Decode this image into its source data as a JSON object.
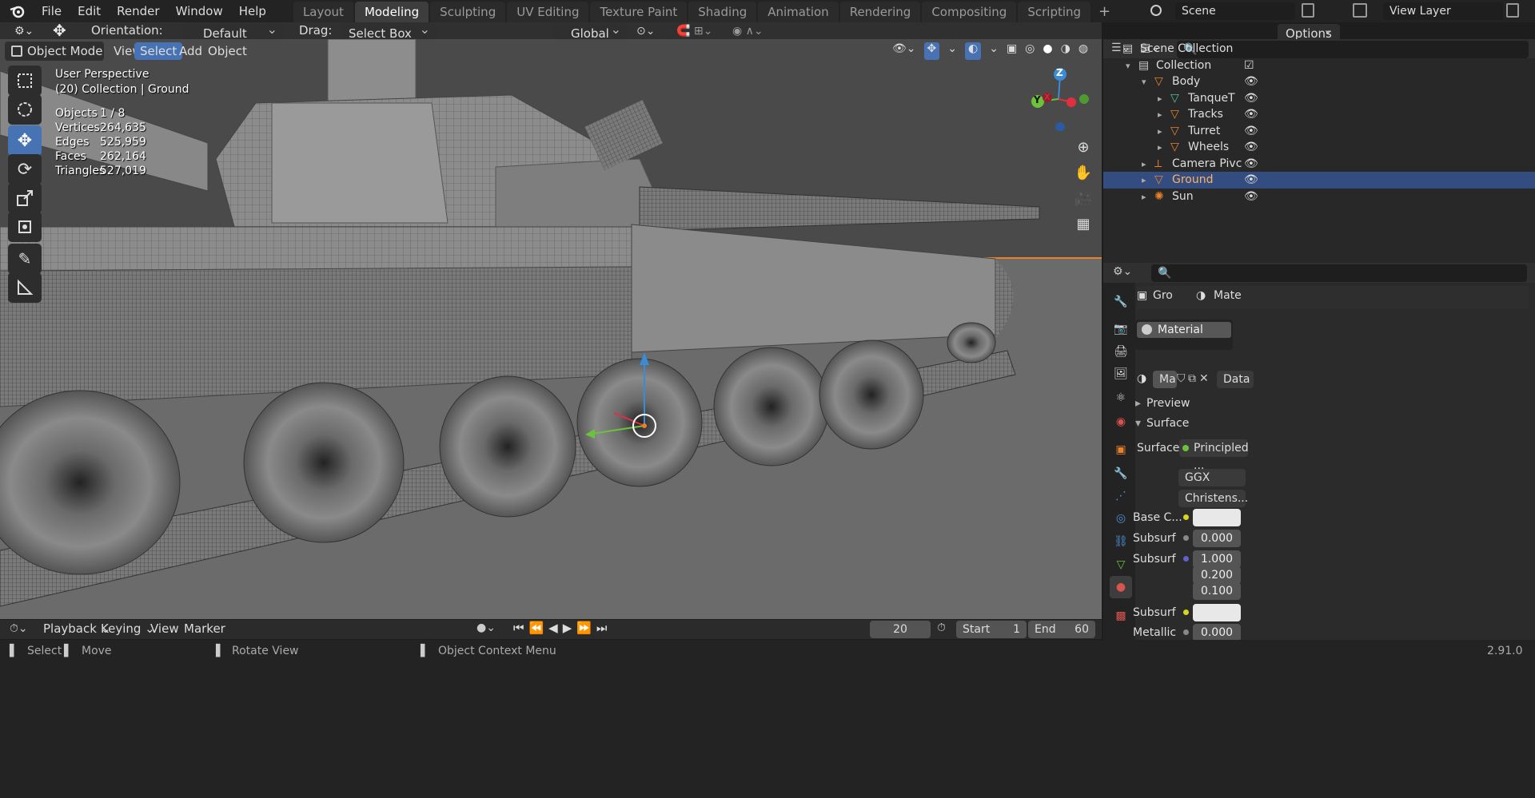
{
  "menu": {
    "items": [
      "File",
      "Edit",
      "Render",
      "Window",
      "Help"
    ]
  },
  "workspaces": {
    "tabs": [
      "Layout",
      "Modeling",
      "Sculpting",
      "UV Editing",
      "Texture Paint",
      "Shading",
      "Animation",
      "Rendering",
      "Compositing",
      "Scripting"
    ],
    "active": "Modeling",
    "add": "+"
  },
  "scene": {
    "label": "Scene"
  },
  "view_layer": {
    "label": "View Layer"
  },
  "header": {
    "orientation_label": "Orientation:",
    "orientation_value": "Default",
    "drag_label": "Drag:",
    "drag_value": "Select Box",
    "transform_value": "Global",
    "options": "Options"
  },
  "viewport_header": {
    "mode": "Object Mode",
    "view": "View",
    "select": "Select",
    "add": "Add",
    "object": "Object"
  },
  "overlay": {
    "perspective": "User Perspective",
    "collection": "(20) Collection | Ground",
    "stats": [
      {
        "label": "Objects",
        "value": "1 / 8"
      },
      {
        "label": "Vertices",
        "value": "264,635"
      },
      {
        "label": "Edges",
        "value": "525,959"
      },
      {
        "label": "Faces",
        "value": "262,164"
      },
      {
        "label": "Triangles",
        "value": "527,019"
      }
    ]
  },
  "gizmo": {
    "z": "Z",
    "y": "Y",
    "x": "X"
  },
  "outliner": {
    "search_placeholder": "",
    "rows": [
      {
        "label": "Scene Collection",
        "indent": 0
      },
      {
        "label": "Collection",
        "indent": 1
      },
      {
        "label": "Body",
        "indent": 2
      },
      {
        "label": "TanqueT",
        "indent": 3
      },
      {
        "label": "Tracks",
        "indent": 3
      },
      {
        "label": "Turret",
        "indent": 3
      },
      {
        "label": "Wheels",
        "indent": 3
      },
      {
        "label": "Camera Pivc",
        "indent": 2
      },
      {
        "label": "Ground",
        "indent": 2,
        "selected": true
      },
      {
        "label": "Sun",
        "indent": 2
      }
    ]
  },
  "properties": {
    "object_short": "Gro",
    "material_short": "Mate",
    "slot": "Material",
    "mat_field": "Ma",
    "data_link": "Data",
    "preview": "Preview",
    "surface_panel": "Surface",
    "surface_label": "Surface",
    "surface_value": "Principled ...",
    "distribution": "GGX",
    "subsurface_method": "Christens...",
    "rows": [
      {
        "label": "Base C...",
        "value": "",
        "kind": "color"
      },
      {
        "label": "Subsurf",
        "value": "0.000",
        "kind": "num"
      },
      {
        "label": "Subsurf",
        "value": "1.000",
        "kind": "num"
      },
      {
        "label": "",
        "value": "0.200",
        "kind": "num"
      },
      {
        "label": "",
        "value": "0.100",
        "kind": "num"
      },
      {
        "label": "Subsurf",
        "value": "",
        "kind": "color"
      },
      {
        "label": "Metallic",
        "value": "0.000",
        "kind": "num"
      }
    ]
  },
  "timeline": {
    "playback": "Playback",
    "keying": "Keying",
    "view": "View",
    "marker": "Marker",
    "frame": "20",
    "start_label": "Start",
    "start": "1",
    "end_label": "End",
    "end": "60"
  },
  "statusbar": {
    "select": "Select",
    "move": "Move",
    "rotate": "Rotate View",
    "context": "Object Context Menu",
    "version": "2.91.0"
  },
  "colors": {
    "accent": "#4772b3",
    "selection_orange": "#e8812a",
    "bg": "#1d1d1d"
  }
}
